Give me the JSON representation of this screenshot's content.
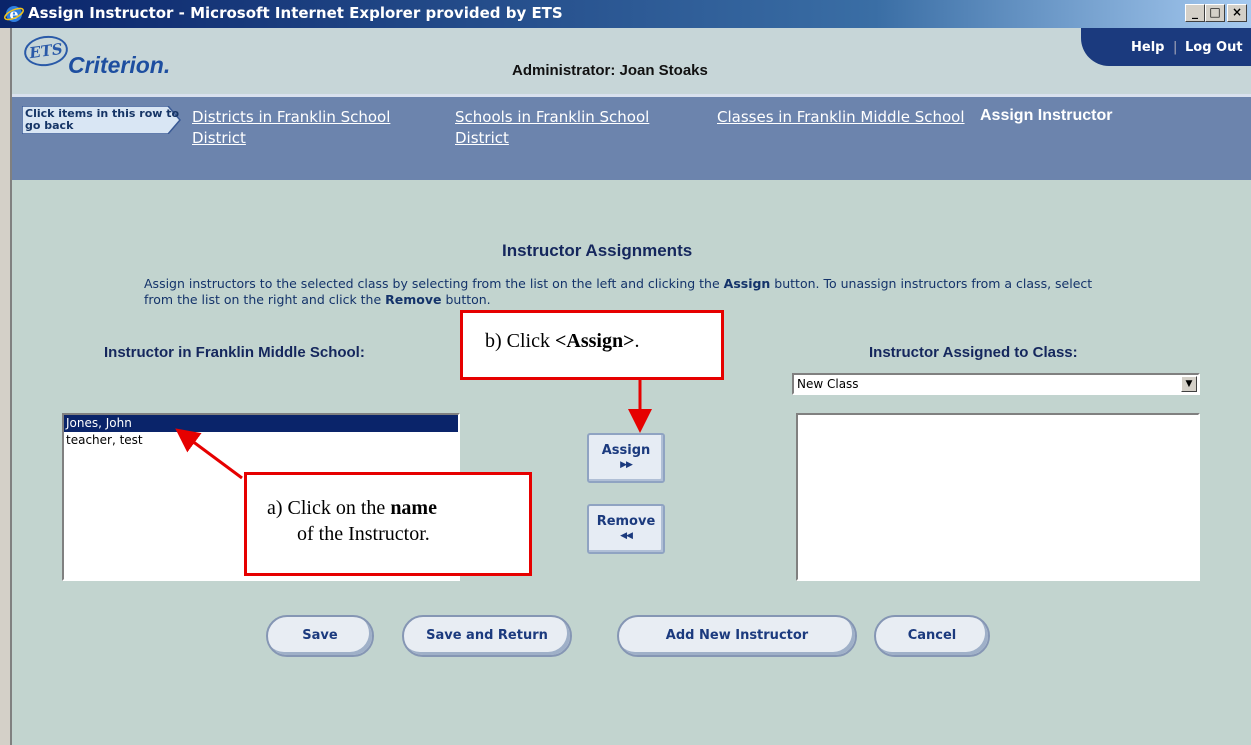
{
  "window": {
    "title": "Assign Instructor - Microsoft Internet Explorer provided by ETS",
    "controls": {
      "minimize": "_",
      "maximize": "□",
      "close": "×"
    }
  },
  "header": {
    "logo_ets": "ETS",
    "logo_name": "Criterion.",
    "admin_label": "Administrator: Joan Stoaks",
    "help": "Help",
    "separator": "|",
    "logout": "Log Out"
  },
  "breadcrumbs": {
    "hint": "Click items in this row to go back",
    "items": [
      {
        "label": "Districts in Franklin School District"
      },
      {
        "label": "Schools in Franklin School District"
      },
      {
        "label": "Classes in Franklin Middle School"
      }
    ],
    "current": "Assign Instructor"
  },
  "main": {
    "heading": "Instructor Assignments",
    "instructions_part1": "Assign instructors to the selected class by selecting from the list on the left and clicking the ",
    "instructions_assign": "Assign",
    "instructions_part2": " button. To unassign instructors from a class, select from the list on the right and click the ",
    "instructions_remove": "Remove",
    "instructions_part3": " button.",
    "left_label": "Instructor in Franklin Middle School:",
    "right_label": "Instructor Assigned to Class:",
    "left_list": [
      {
        "label": "Jones, John",
        "selected": true
      },
      {
        "label": "teacher, test",
        "selected": false
      }
    ],
    "class_select_value": "New Class",
    "assign_button": "Assign",
    "assign_arrows": "▶▶",
    "remove_button": "Remove",
    "remove_arrows": "◀◀"
  },
  "footer_buttons": {
    "save": "Save",
    "save_return": "Save and Return",
    "add_new": "Add New Instructor",
    "cancel": "Cancel"
  },
  "callouts": {
    "a_prefix": "a)  Click on the ",
    "a_bold": "name",
    "a_suffix": "of the Instructor.",
    "b_prefix": "b)  Click ",
    "b_bold": "<Assign>",
    "b_suffix": "."
  },
  "colors": {
    "breadcrumb_band": "#6c84ad",
    "page_bg": "#c2d4cf",
    "help_bar": "#1b3a7e",
    "callout_border": "#e60000",
    "selected_row": "#0a246a"
  }
}
